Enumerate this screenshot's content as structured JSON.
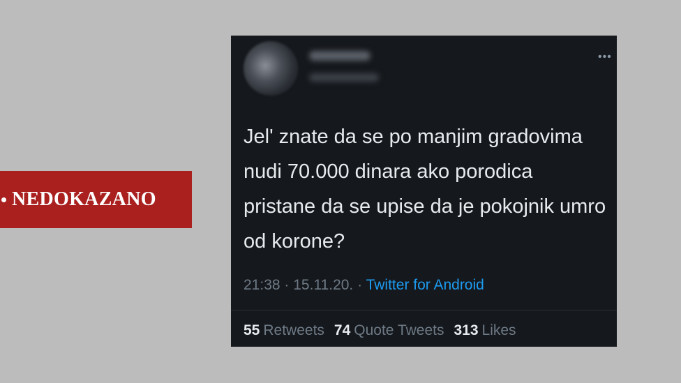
{
  "label": {
    "text": "NEDOKAZANO",
    "color": "#a9201f"
  },
  "tweet": {
    "text": "Jel' znate da se po manjim gradovima nudi 70.000 dinara ako porodica pristane da se upise da je pokojnik umro od korone?",
    "time": "21:38",
    "date": "15.11.20.",
    "separator": "·",
    "source": "Twitter for Android",
    "more_icon": "•••",
    "stats": [
      {
        "value": "55",
        "label": "Retweets"
      },
      {
        "value": "74",
        "label": "Quote Tweets"
      },
      {
        "value": "313",
        "label": "Likes"
      }
    ]
  }
}
